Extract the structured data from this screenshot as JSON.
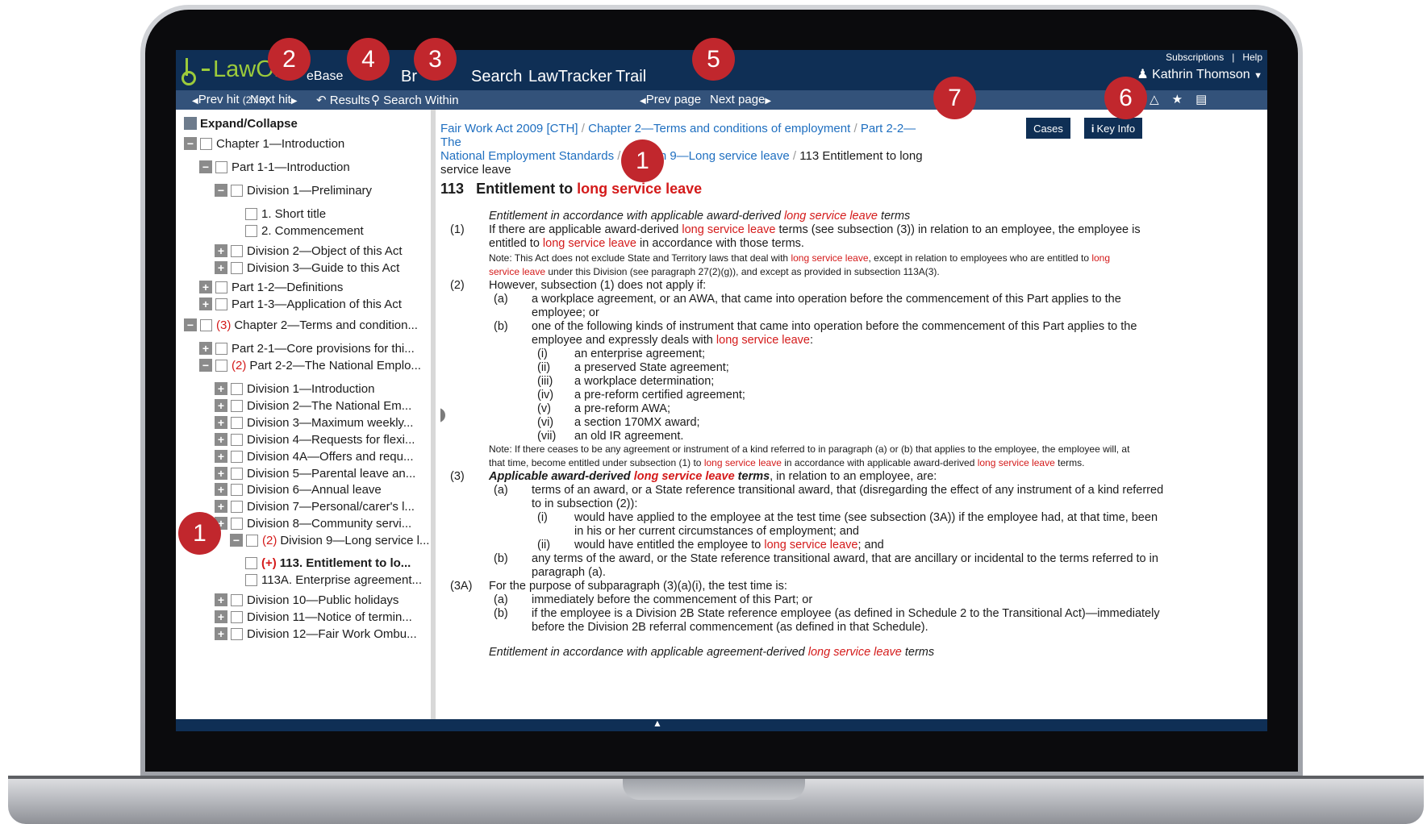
{
  "app": {
    "logo": "LawOne",
    "top_nav": [
      "eBase",
      "Br",
      "Search",
      "LawTracker",
      "Trail"
    ],
    "top_links": "Subscriptions   |   Help",
    "user": "Kathrin Thomson",
    "user_icon": "person-icon"
  },
  "subbar": {
    "prev_hit": "Prev hit",
    "hit_count": "(2 / 3)",
    "next_hit": "Next hit",
    "results": "Results",
    "search_within": "Search Within",
    "prev_page": "Prev page",
    "next_page": "Next page",
    "icons": [
      "comment-icon",
      "bell-icon",
      "star-icon",
      "print-icon"
    ]
  },
  "tree": {
    "expand_collapse": "Expand/Collapse",
    "items": [
      {
        "label": "Chapter 1—Introduction",
        "prefix": "",
        "toggle": "−"
      },
      {
        "label": "Part 1-1—Introduction",
        "prefix": "",
        "toggle": "−"
      },
      {
        "label": "Division 1—Preliminary",
        "prefix": "",
        "toggle": "−"
      },
      {
        "label": "1. Short title",
        "prefix": "",
        "toggle": ""
      },
      {
        "label": "2. Commencement",
        "prefix": "",
        "toggle": ""
      },
      {
        "label": "Division 2—Object of this Act",
        "prefix": "",
        "toggle": "+"
      },
      {
        "label": "Division 3—Guide to this Act",
        "prefix": "",
        "toggle": "+"
      },
      {
        "label": "Part 1-2—Definitions",
        "prefix": "",
        "toggle": "+"
      },
      {
        "label": "Part 1-3—Application of this Act",
        "prefix": "",
        "toggle": "+"
      },
      {
        "label": "Chapter 2—Terms and condition...",
        "prefix": "(3)",
        "toggle": "−"
      },
      {
        "label": "Part 2-1—Core provisions for thi...",
        "prefix": "",
        "toggle": "+"
      },
      {
        "label": "Part 2-2—The National Emplo...",
        "prefix": "(2)",
        "toggle": "−"
      },
      {
        "label": "Division 1—Introduction",
        "prefix": "",
        "toggle": "+"
      },
      {
        "label": "Division 2—The National Em...",
        "prefix": "",
        "toggle": "+"
      },
      {
        "label": "Division 3—Maximum weekly...",
        "prefix": "",
        "toggle": "+"
      },
      {
        "label": "Division 4—Requests for flexi...",
        "prefix": "",
        "toggle": "+"
      },
      {
        "label": "Division 4A—Offers and requ...",
        "prefix": "",
        "toggle": "+"
      },
      {
        "label": "Division 5—Parental leave an...",
        "prefix": "",
        "toggle": "+"
      },
      {
        "label": "Division 6—Annual leave",
        "prefix": "",
        "toggle": "+"
      },
      {
        "label": "Division 7—Personal/carer's l...",
        "prefix": "",
        "toggle": "+"
      },
      {
        "label": "Division 8—Community servi...",
        "prefix": "",
        "toggle": "+"
      },
      {
        "label": "Division 9—Long service l...",
        "prefix": "(2)",
        "toggle": "−"
      },
      {
        "label": "113. Entitlement to lo...",
        "prefix": "(+)",
        "toggle": ""
      },
      {
        "label": "113A. Enterprise agreement...",
        "prefix": "",
        "toggle": ""
      },
      {
        "label": "Division 10—Public holidays",
        "prefix": "",
        "toggle": "+"
      },
      {
        "label": "Division 11—Notice of termin...",
        "prefix": "",
        "toggle": "+"
      },
      {
        "label": "Division 12—Fair Work Ombu...",
        "prefix": "",
        "toggle": "+"
      }
    ]
  },
  "document": {
    "breadcrumb": [
      "Fair Work Act 2009 [CTH]",
      "Chapter 2—Terms and conditions of employment",
      "Part 2-2—The",
      "National Employment Standards",
      "Division 9—Long service leave",
      "113 Entitlement to long",
      "service leave"
    ],
    "breadcrumb_sep": "/",
    "cases_button": "Cases",
    "keyinfo_button": "Key Info",
    "heading_num": "113",
    "heading_text": "Entitlement to",
    "heading_hl": "long service leave",
    "highlight_term": "long service leave",
    "lines": {
      "s1_heading_a": "Entitlement in accordance with applicable award-derived",
      "s1_heading_b": "terms",
      "s1_num": "(1)",
      "s1_a": "If there are applicable award-derived",
      "s1_b": "terms (see subsection (3)) in relation to an employee, the employee is",
      "s1_c": "entitled to",
      "s1_d": "in accordance with those terms.",
      "note1_a": "Note: This Act does not exclude State and Territory laws that deal with",
      "note1_b": ", except in relation to employees who are entitled to",
      "note1_c": "service leave",
      "note1_d": "under this Division (see paragraph 27(2)(g)), and except as provided in subsection 113A(3).",
      "note1_e": "long",
      "s2_num": "(2)",
      "s2": "However, subsection (1) does not apply if:",
      "s2a_num": "(a)",
      "s2a_1": "a workplace agreement, or an AWA, that came into operation before the commencement of this Part applies to the",
      "s2a_2": "employee; or",
      "s2b_num": "(b)",
      "s2b_1": "one of the following kinds of instrument that came into operation before the commencement of this Part applies to the",
      "s2b_2": "employee and expressly deals with",
      "roman": [
        {
          "num": "(i)",
          "text": "an enterprise agreement;"
        },
        {
          "num": "(ii)",
          "text": "a preserved State agreement;"
        },
        {
          "num": "(iii)",
          "text": "a workplace determination;"
        },
        {
          "num": "(iv)",
          "text": "a pre-reform certified agreement;"
        },
        {
          "num": "(v)",
          "text": "a pre-reform AWA;"
        },
        {
          "num": "(vi)",
          "text": "a section 170MX award;"
        },
        {
          "num": "(vii)",
          "text": "an old IR agreement."
        }
      ],
      "note2_a": "Note: If there ceases to be any agreement or instrument of a kind referred to in paragraph (a) or (b) that applies to the employee, the employee will, at",
      "note2_b": "that time, become entitled under subsection (1) to",
      "note2_c": "in accordance with applicable award-derived",
      "note2_d": "terms.",
      "s3_num": "(3)",
      "s3_a": "Applicable award-derived",
      "s3_b": "terms",
      "s3_c": ", in relation to an employee, are:",
      "s3a_num": "(a)",
      "s3a_1": "terms of an award, or a State reference transitional award, that (disregarding the effect of any instrument of a kind referred",
      "s3a_2": "to in subsection (2)):",
      "s3ai_num": "(i)",
      "s3ai_1": "would have applied to the employee at the test time (see subsection (3A)) if the employee had, at that time, been",
      "s3ai_2": "in his or her current circumstances of employment; and",
      "s3aii_num": "(ii)",
      "s3aii_a": "would have entitled the employee to",
      "s3aii_b": "; and",
      "s3b_num": "(b)",
      "s3b_1": "any terms of the award, or the State reference transitional award, that are ancillary or incidental to the terms referred to in",
      "s3b_2": "paragraph (a).",
      "s3A_num": "(3A)",
      "s3A": "For the purpose of subparagraph (3)(a)(i), the test time is:",
      "s3Aa_num": "(a)",
      "s3Aa": "immediately before the commencement of this Part; or",
      "s3Ab_num": "(b)",
      "s3Ab_1": "if the employee is a Division 2B State reference employee (as defined in Schedule 2 to the Transitional Act)—immediately",
      "s3Ab_2": "before the Division 2B referral commencement (as defined in that Schedule).",
      "cut_a": "Entitlement in accordance with applicable agreement-derived",
      "cut_b": "terms"
    }
  },
  "callouts": [
    "2",
    "4",
    "3",
    "5",
    "7",
    "6",
    "1",
    "1"
  ],
  "colors": {
    "navy": "#0f2f55",
    "subbar": "#33527a",
    "logo_green": "#9ccb3b",
    "link_blue": "#1f6fc0",
    "highlight_red": "#d41a1a",
    "badge_red": "#c1272d"
  }
}
